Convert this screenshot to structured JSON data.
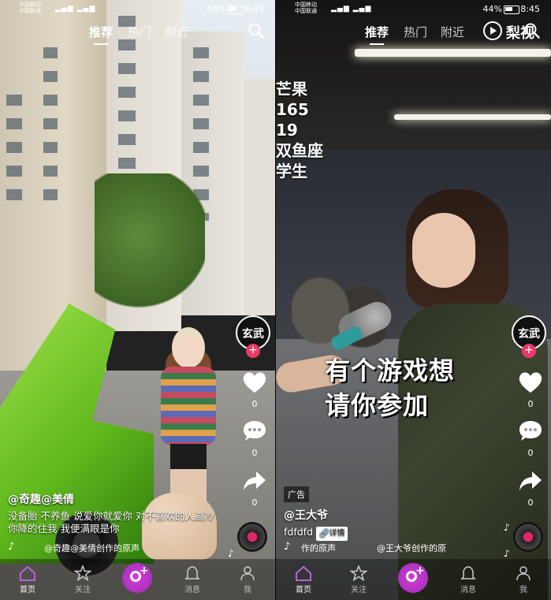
{
  "status_bar": {
    "carrier_line1": "中国移动",
    "carrier_line2": "中国联通",
    "battery": "44%",
    "time": "8:45"
  },
  "top_tabs": {
    "recommend": "推荐",
    "hot": "热门",
    "nearby": "附近"
  },
  "left_panel": {
    "author": "@奇趣@美倩",
    "description": "没备胎 不养鱼 说爱你就爱你 对不喜欢的人高冷 你降的住我 我便满眼是你",
    "music": "@奇趣@美倩创作的原声",
    "avatar_text": "玄武",
    "likes": "0",
    "comments": "0",
    "shares": "0"
  },
  "right_panel": {
    "brand_text": "梨视",
    "info_lines": [
      "芒果",
      "165",
      "19",
      "双鱼座",
      "学生"
    ],
    "banner_line1": "有个游戏想",
    "banner_line2": "请你参加",
    "ad_tag": "广告",
    "author": "@王大爷",
    "description": "fdfdfd",
    "detail_tag": "详情",
    "music_left": "作的原声",
    "music_right": "@王大爷创作的原",
    "avatar_text": "玄武",
    "likes": "0",
    "comments": "0",
    "shares": "0"
  },
  "bottom_nav": {
    "home": "首页",
    "follow": "关注",
    "messages": "消息",
    "me": "我"
  },
  "colors": {
    "accent_pink": "#e83a69",
    "create_purple": "#b033c7"
  }
}
